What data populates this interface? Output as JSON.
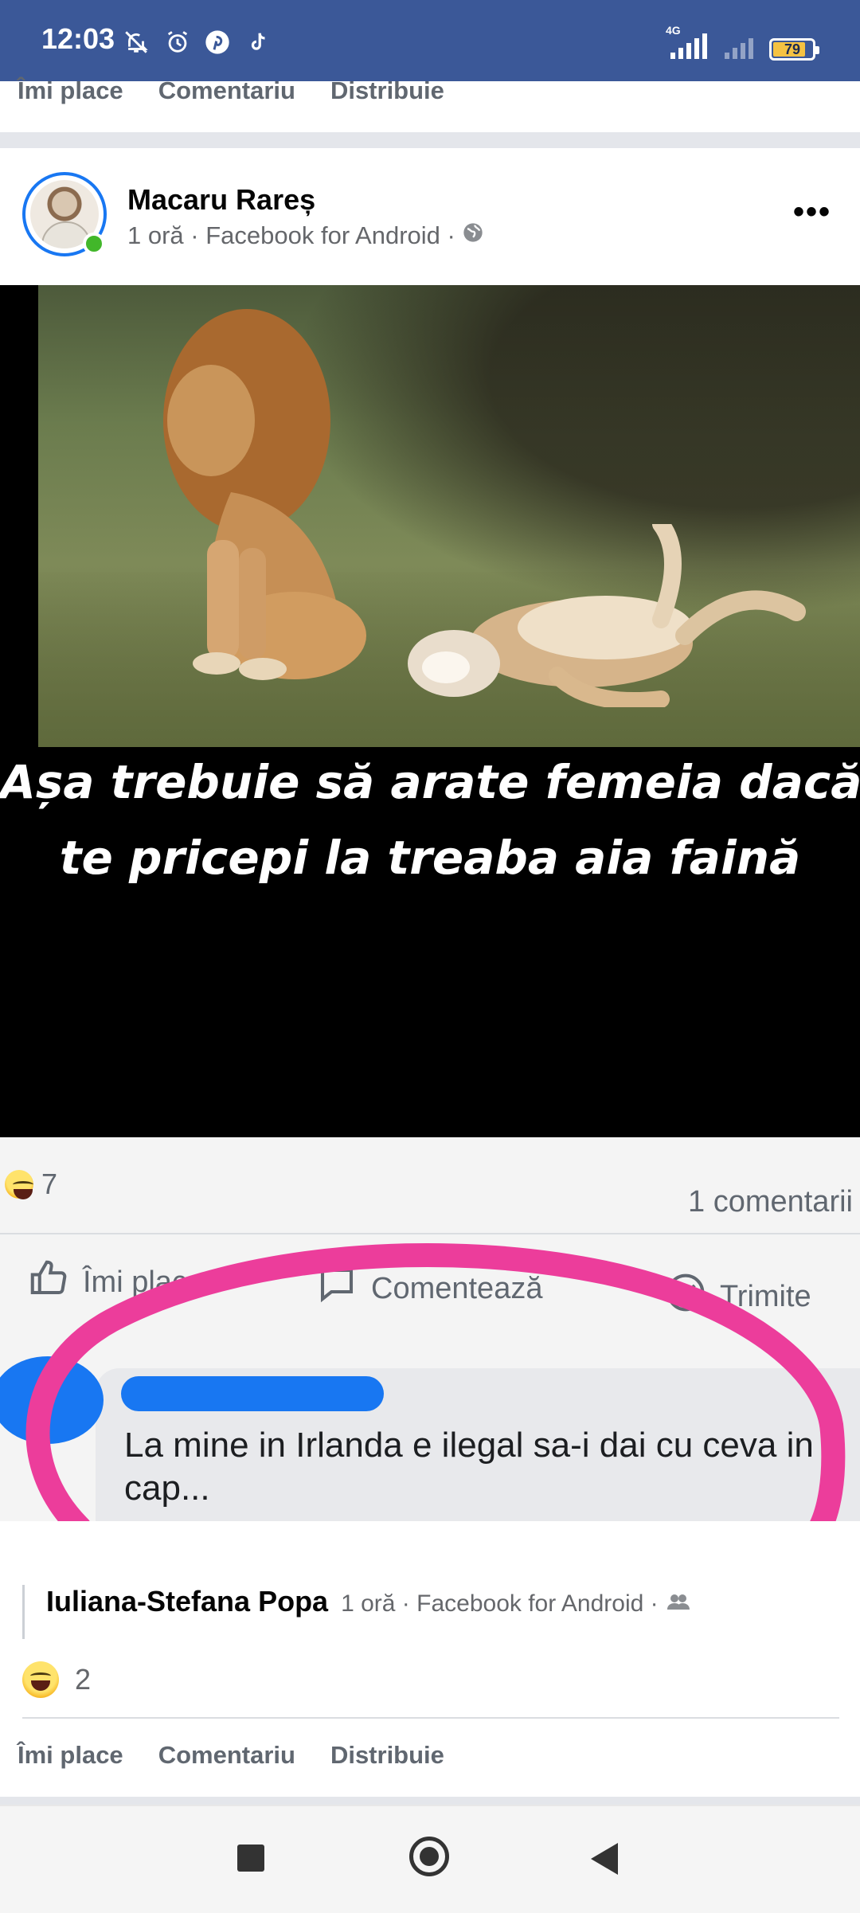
{
  "status_bar": {
    "time": "12:03",
    "network": "4G",
    "battery": "79",
    "icons": [
      "mute-icon",
      "alarm-icon",
      "pinterest-icon",
      "tiktok-icon",
      "signal-icon",
      "signal-weak-icon",
      "battery-icon"
    ]
  },
  "top_actions": {
    "like": "Îmi place",
    "comment": "Comentariu",
    "share": "Distribuie"
  },
  "post": {
    "author": "Macaru Rareș",
    "meta": "1 oră · Facebook for Android ·",
    "meme": {
      "caption_line1": "Așa trebuie să arate femeia dacă",
      "caption_line2": "te pricepi la treaba aia faină",
      "inner_reaction_count": "7",
      "inner_comments": "1 comentarii",
      "inner_like": "Îmi place",
      "inner_comment": "Comentează",
      "inner_send": "Trimite",
      "inner_comment_text": "La mine in Irlanda e ilegal sa-i dai cu ceva in cap...",
      "highlight_color": "#ec3d9b"
    }
  },
  "shared_by": {
    "name": "Iuliana-Stefana Popa",
    "meta": "1 oră · Facebook for Android ·",
    "reaction_count": "2"
  },
  "bottom_actions": {
    "like": "Îmi place",
    "comment": "Comentariu",
    "share": "Distribuie"
  },
  "colors": {
    "status_bar": "#3b5898",
    "accent": "#1877f2",
    "online": "#42b72a"
  }
}
